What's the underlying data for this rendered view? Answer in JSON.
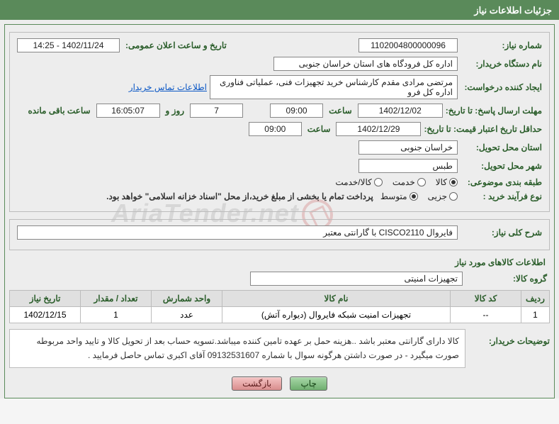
{
  "header": {
    "title": "جزئیات اطلاعات نیاز"
  },
  "fields": {
    "need_number": {
      "label": "شماره نیاز:",
      "value": "1102004800000096"
    },
    "announce_datetime": {
      "label": "تاریخ و ساعت اعلان عمومی:",
      "value": "1402/11/24 - 14:25"
    },
    "buyer_org": {
      "label": "نام دستگاه خریدار:",
      "value": "اداره کل فرودگاه های استان خراسان جنوبی"
    },
    "requester": {
      "label": "ایجاد کننده درخواست:",
      "value": "مرتضی مرادی مقدم کارشناس خرید تجهیزات فنی، عملیاتی فناوری اداره کل فرو"
    },
    "buyer_contact_link": "اطلاعات تماس خریدار",
    "reply_deadline": {
      "label": "مهلت ارسال پاسخ: تا تاریخ:",
      "date": "1402/12/02",
      "time_label": "ساعت",
      "time": "09:00",
      "days_label": "روز و",
      "days": "7",
      "remaining_time": "16:05:07",
      "remaining_label": "ساعت باقی مانده"
    },
    "price_validity": {
      "label": "حداقل تاریخ اعتبار قیمت: تا تاریخ:",
      "date": "1402/12/29",
      "time_label": "ساعت",
      "time": "09:00"
    },
    "delivery_province": {
      "label": "استان محل تحویل:",
      "value": "خراسان جنوبی"
    },
    "delivery_city": {
      "label": "شهر محل تحویل:",
      "value": "طبس"
    },
    "category": {
      "label": "طبقه بندی موضوعی:",
      "options": [
        "کالا",
        "خدمت",
        "کالا/خدمت"
      ],
      "selected": 0
    },
    "buy_process": {
      "label": "نوع فرآیند خرید :",
      "options": [
        "جزیی",
        "متوسط"
      ],
      "selected": 1,
      "note": "پرداخت تمام یا بخشی از مبلغ خرید،از محل \"اسناد خزانه اسلامی\" خواهد بود."
    }
  },
  "overview": {
    "label": "شرح کلی نیاز:",
    "text": "فایروال CISCO2110 با گارانتی معتبر"
  },
  "goods_section_title": "اطلاعات کالاهای مورد نیاز",
  "goods_group": {
    "label": "گروه کالا:",
    "value": "تجهیزات امنیتی"
  },
  "table": {
    "headers": [
      "ردیف",
      "کد کالا",
      "نام کالا",
      "واحد شمارش",
      "تعداد / مقدار",
      "تاریخ نیاز"
    ],
    "rows": [
      {
        "idx": "1",
        "code": "--",
        "name": "تجهیزات امنیت شبکه فایروال (دیواره آتش)",
        "unit": "عدد",
        "qty": "1",
        "date": "1402/12/15"
      }
    ]
  },
  "buyer_notes": {
    "label": "توضیحات خریدار:",
    "text": "کالا دارای گارانتی معتبر باشد ..هزینه حمل بر عهده تامین کننده میباشد.تسویه حساب بعد از تحویل کالا و تایید واحد مربوطه صورت میگیرد - در صورت داشتن هرگونه سوال با شماره 09132531607 آقای اکبری تماس حاصل فرمایید ."
  },
  "buttons": {
    "print": "چاپ",
    "back": "بازگشت"
  },
  "watermark": "AriaTender.net"
}
